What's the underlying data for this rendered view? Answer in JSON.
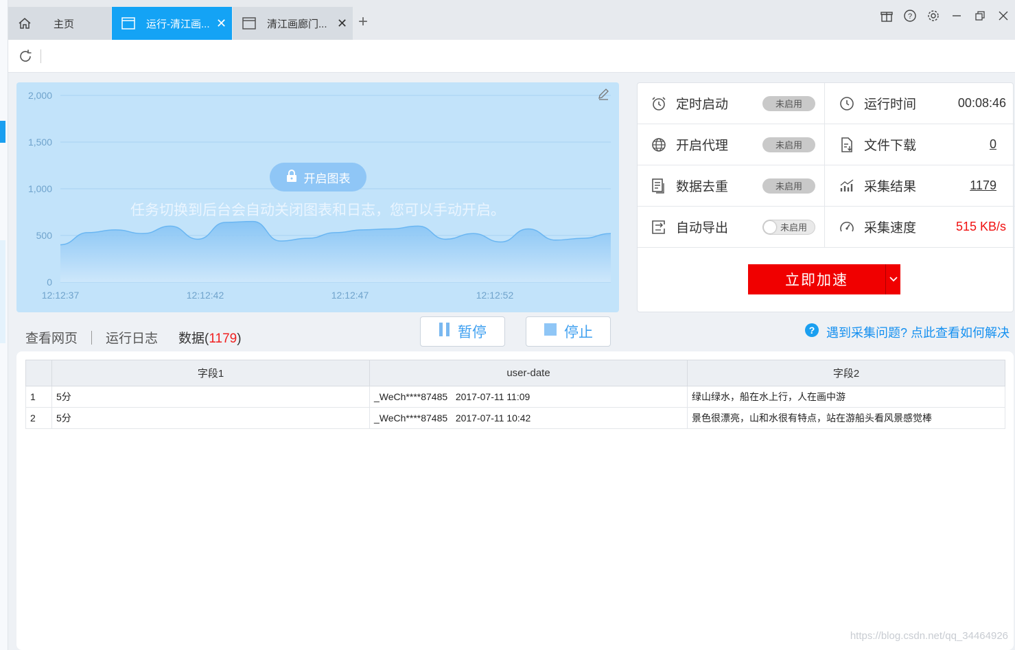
{
  "tabs": [
    {
      "label": "主页"
    },
    {
      "label": "运行-清江画..."
    },
    {
      "label": "清江画廊门..."
    }
  ],
  "chart_overlay": {
    "button_label": "开启图表",
    "notice": "任务切换到后台会自动关闭图表和日志，您可以手动开启。"
  },
  "chart_data": {
    "type": "area",
    "x_tick_labels": [
      "12:12:37",
      "12:12:42",
      "12:12:47",
      "12:12:52"
    ],
    "y_tick_labels": [
      "2,000",
      "1,500",
      "1,000",
      "500",
      "0"
    ],
    "ylim": [
      0,
      2000
    ],
    "grid": true,
    "color": "#7fc0f4",
    "x": [
      0,
      1,
      2,
      3,
      4,
      5,
      6,
      7,
      8,
      9,
      10,
      11,
      12,
      13,
      14,
      15,
      16,
      17,
      18,
      19,
      20
    ],
    "values": [
      400,
      530,
      560,
      520,
      600,
      460,
      640,
      650,
      440,
      470,
      530,
      560,
      570,
      600,
      460,
      520,
      430,
      570,
      450,
      470,
      520
    ]
  },
  "stats": {
    "scheduled_start": {
      "label": "定时启动",
      "toggle": "未启用"
    },
    "run_time": {
      "label": "运行时间",
      "value": "00:08:46"
    },
    "proxy": {
      "label": "开启代理",
      "toggle": "未启用"
    },
    "file_download": {
      "label": "文件下载",
      "value": "0"
    },
    "dedupe": {
      "label": "数据去重",
      "toggle": "未启用"
    },
    "results": {
      "label": "采集结果",
      "value": "1179"
    },
    "auto_export": {
      "label": "自动导出",
      "toggle": "未启用"
    },
    "speed": {
      "label": "采集速度",
      "value": "515 KB/s"
    },
    "accelerate_label": "立即加速"
  },
  "bottom_tabs": {
    "view_page": "查看网页",
    "run_log": "运行日志",
    "data_label": "数据(",
    "data_count": "1179",
    "data_close": ")"
  },
  "controls": {
    "pause": "暂停",
    "stop": "停止",
    "help": "遇到采集问题? 点此查看如何解决"
  },
  "table": {
    "headers": [
      "",
      "字段1",
      "user-date",
      "字段2"
    ],
    "rows": [
      [
        "1",
        "5分",
        "_WeCh****87485   2017-07-11 11:09",
        "绿山绿水，船在水上行，人在画中游"
      ],
      [
        "2",
        "5分",
        "_WeCh****87485   2017-07-11 10:42",
        "景色很漂亮，山和水很有特点，站在游船头看风景感觉棒"
      ]
    ]
  },
  "watermark": "https://blog.csdn.net/qq_34464926"
}
